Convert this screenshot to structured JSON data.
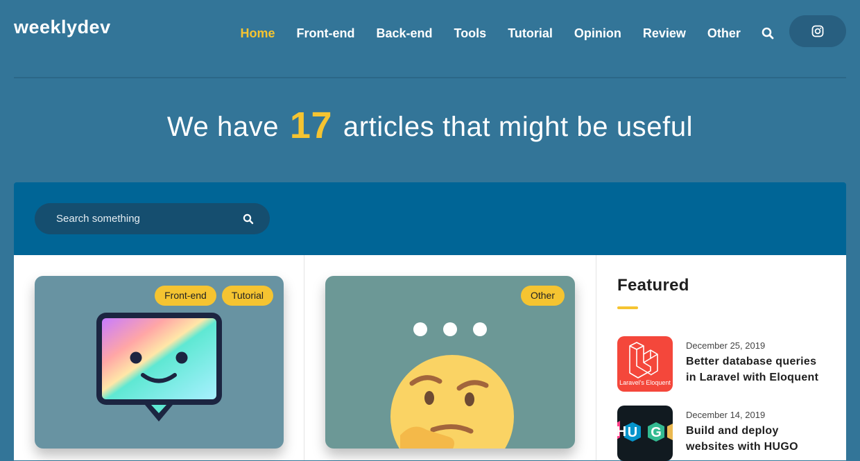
{
  "header": {
    "brand": "weeklydev",
    "nav": [
      "Home",
      "Front-end",
      "Back-end",
      "Tools",
      "Tutorial",
      "Opinion",
      "Review",
      "Other"
    ],
    "active_nav": "Home",
    "search_icon": "search-icon",
    "social_icon": "instagram-icon"
  },
  "hero": {
    "prefix": "We have",
    "count": "17",
    "suffix": "articles that might be useful"
  },
  "search": {
    "placeholder": "Search something",
    "icon": "search-icon"
  },
  "cards": [
    {
      "tags": [
        "Front-end",
        "Tutorial"
      ],
      "image": "smiling-chat-bubble"
    },
    {
      "tags": [
        "Other"
      ],
      "image": "thinking-face-emoji"
    }
  ],
  "featured": {
    "heading": "Featured",
    "items": [
      {
        "date": "December 25, 2019",
        "title": "Better database queries in Laravel with Eloquent",
        "thumb_caption": "Laravel's Eloquent"
      },
      {
        "date": "December 14, 2019",
        "title": "Build and deploy websites with HUGO",
        "thumb_caption": "HUGO"
      }
    ]
  },
  "colors": {
    "background": "#337598",
    "accent": "#f5c431",
    "search_band": "#006596",
    "laravel_red": "#f4473b"
  }
}
